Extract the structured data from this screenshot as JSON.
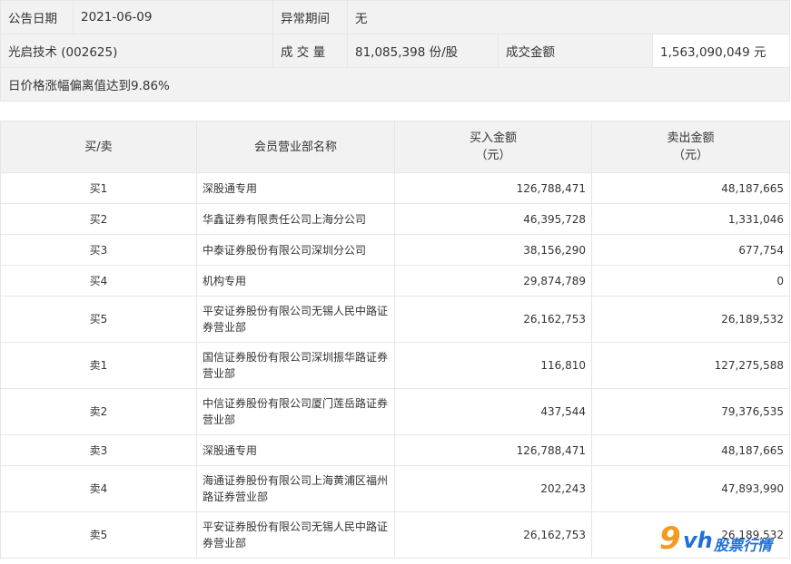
{
  "info": {
    "announce_date_label": "公告日期",
    "announce_date": "2021-06-09",
    "abnormal_period_label": "异常期间",
    "abnormal_period": "无",
    "stock": "光启技术 (002625)",
    "volume_label": "成 交 量",
    "volume": "81,085,398 份/股",
    "amount_label": "成交金额",
    "amount": "1,563,090,049 元",
    "reason": "日价格涨幅偏离值达到9.86%"
  },
  "table": {
    "headers": {
      "side": "买/卖",
      "dept": "会员营业部名称",
      "buy": "买入金额\n（元）",
      "sell": "卖出金额\n（元）"
    },
    "rows": [
      {
        "side": "买1",
        "dept": "深股通专用",
        "buy": "126,788,471",
        "sell": "48,187,665"
      },
      {
        "side": "买2",
        "dept": "华鑫证券有限责任公司上海分公司",
        "buy": "46,395,728",
        "sell": "1,331,046"
      },
      {
        "side": "买3",
        "dept": "中泰证券股份有限公司深圳分公司",
        "buy": "38,156,290",
        "sell": "677,754"
      },
      {
        "side": "买4",
        "dept": "机构专用",
        "buy": "29,874,789",
        "sell": "0"
      },
      {
        "side": "买5",
        "dept": "平安证券股份有限公司无锡人民中路证券营业部",
        "buy": "26,162,753",
        "sell": "26,189,532"
      },
      {
        "side": "卖1",
        "dept": "国信证券股份有限公司深圳振华路证券营业部",
        "buy": "116,810",
        "sell": "127,275,588"
      },
      {
        "side": "卖2",
        "dept": "中信证券股份有限公司厦门莲岳路证券营业部",
        "buy": "437,544",
        "sell": "79,376,535"
      },
      {
        "side": "卖3",
        "dept": "深股通专用",
        "buy": "126,788,471",
        "sell": "48,187,665"
      },
      {
        "side": "卖4",
        "dept": "海通证券股份有限公司上海黄浦区福州路证券营业部",
        "buy": "202,243",
        "sell": "47,893,990"
      },
      {
        "side": "卖5",
        "dept": "平安证券股份有限公司无锡人民中路证券营业部",
        "buy": "26,162,753",
        "sell": "26,189,532"
      }
    ]
  },
  "watermark": {
    "nine": "9",
    "vh": "vh",
    "text": "股票行情"
  }
}
